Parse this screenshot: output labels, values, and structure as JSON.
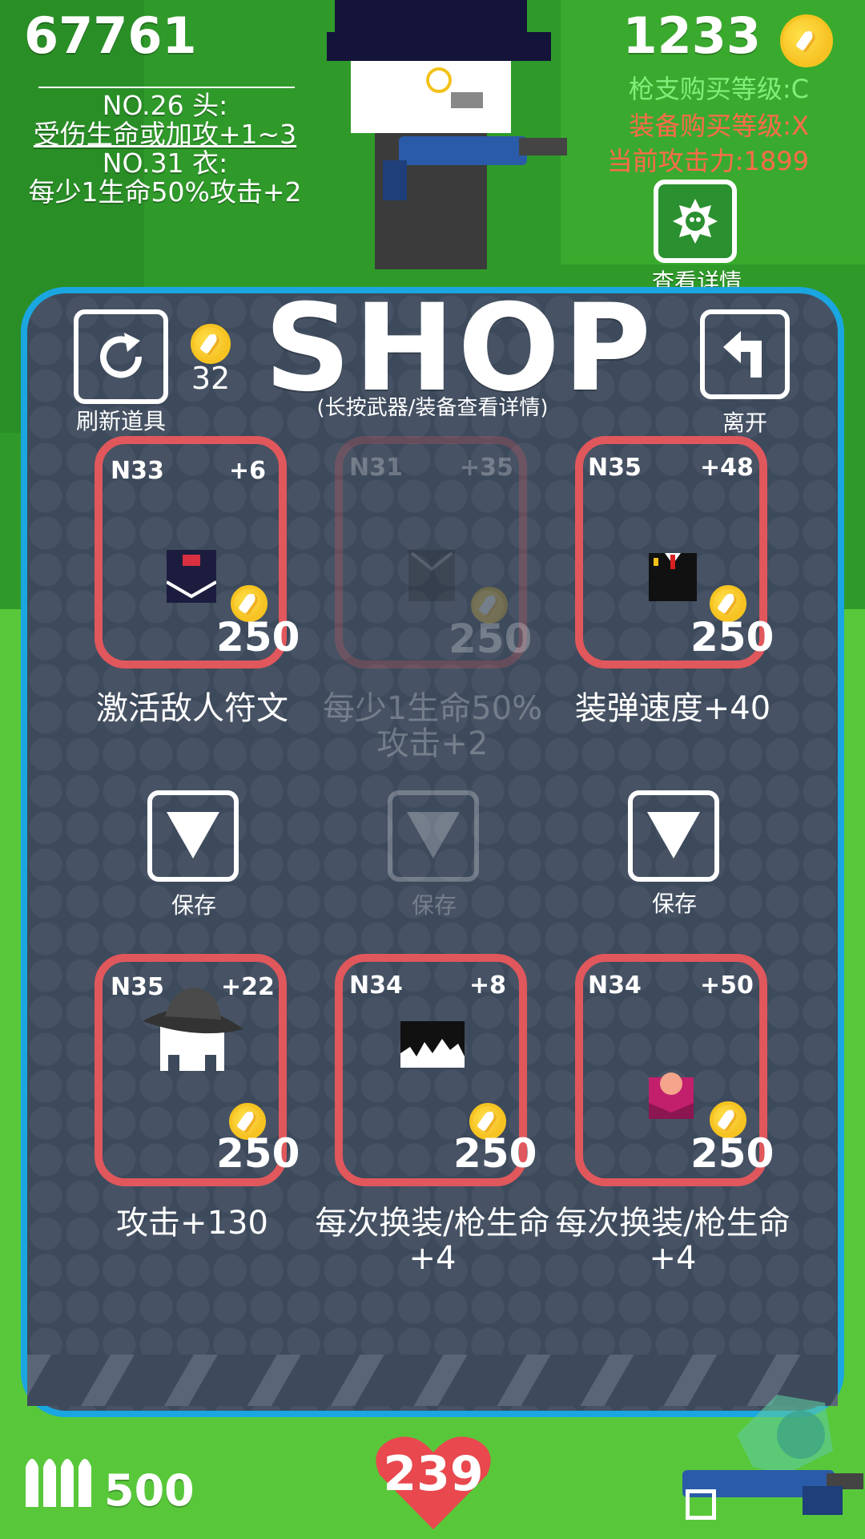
{
  "hud": {
    "score": "67761",
    "coins": "1233",
    "equipped": {
      "line1": "NO.26 头:",
      "line2": "受伤生命或加攻+1~3",
      "line3": "NO.31 衣:",
      "line4": "每少1生命50%攻击+2"
    },
    "stats": {
      "gun_level": "枪支购买等级:C",
      "gear_level": "装备购买等级:X",
      "attack": "当前攻击力:1899"
    },
    "details_label": "查看详情"
  },
  "shop": {
    "title": "SHOP",
    "subtitle": "(长按武器/装备查看详情)",
    "refresh_label": "刷新道具",
    "refresh_cost": "32",
    "leave_label": "离开",
    "save_label": "保存",
    "items_top": [
      {
        "id": "N33",
        "plus": "+6",
        "price": "250",
        "desc": "激活敌人符文",
        "available": true,
        "icon": "vest-icon"
      },
      {
        "id": "N31",
        "plus": "+35",
        "price": "250",
        "desc": "每少1生命50%攻击+2",
        "available": false,
        "icon": "coat-icon"
      },
      {
        "id": "N35",
        "plus": "+48",
        "price": "250",
        "desc": "装弹速度+40",
        "available": true,
        "icon": "suit-icon"
      }
    ],
    "items_bottom": [
      {
        "id": "N35",
        "plus": "+22",
        "price": "250",
        "desc": "攻击+130",
        "available": true,
        "icon": "fedora-hat-icon"
      },
      {
        "id": "N34",
        "plus": "+8",
        "price": "250",
        "desc": "每次换装/枪生命+4",
        "available": true,
        "icon": "hair-icon"
      },
      {
        "id": "N34",
        "plus": "+50",
        "price": "250",
        "desc": "每次换装/枪生命+4",
        "available": true,
        "icon": "pink-head-icon"
      }
    ]
  },
  "bottom": {
    "ammo": "500",
    "hp": "239"
  },
  "colors": {
    "panel_bg": "#3d4a5c",
    "panel_border": "#1aa6e0",
    "card_border": "#e0575c",
    "grass": "#45b82c",
    "gun_level_color": "#7ef07a",
    "gear_level_color": "#ff6b4a"
  }
}
